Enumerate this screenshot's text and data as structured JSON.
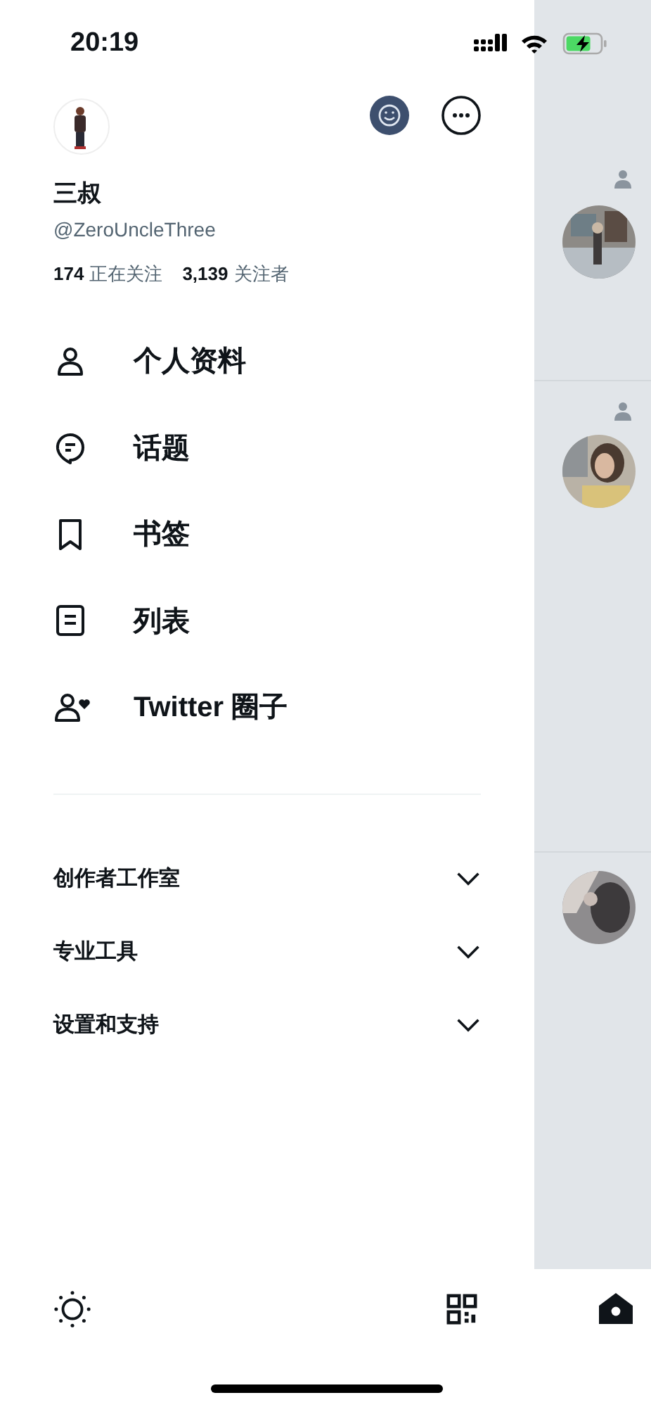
{
  "status_bar": {
    "time": "20:19"
  },
  "profile": {
    "name": "三叔",
    "handle": "@ZeroUncleThree",
    "following_count": "174",
    "following_label": "正在关注",
    "followers_count": "3,139",
    "followers_label": "关注者"
  },
  "menu": [
    {
      "kind": "profile",
      "label": "个人资料"
    },
    {
      "kind": "topics",
      "label": "话题"
    },
    {
      "kind": "bookmarks",
      "label": "书签"
    },
    {
      "kind": "lists",
      "label": "列表"
    },
    {
      "kind": "circle",
      "label": "Twitter 圈子"
    }
  ],
  "sections": [
    {
      "label": "创作者工作室",
      "expanded": false
    },
    {
      "label": "专业工具",
      "expanded": false
    },
    {
      "label": "设置和支持",
      "expanded": false
    }
  ]
}
